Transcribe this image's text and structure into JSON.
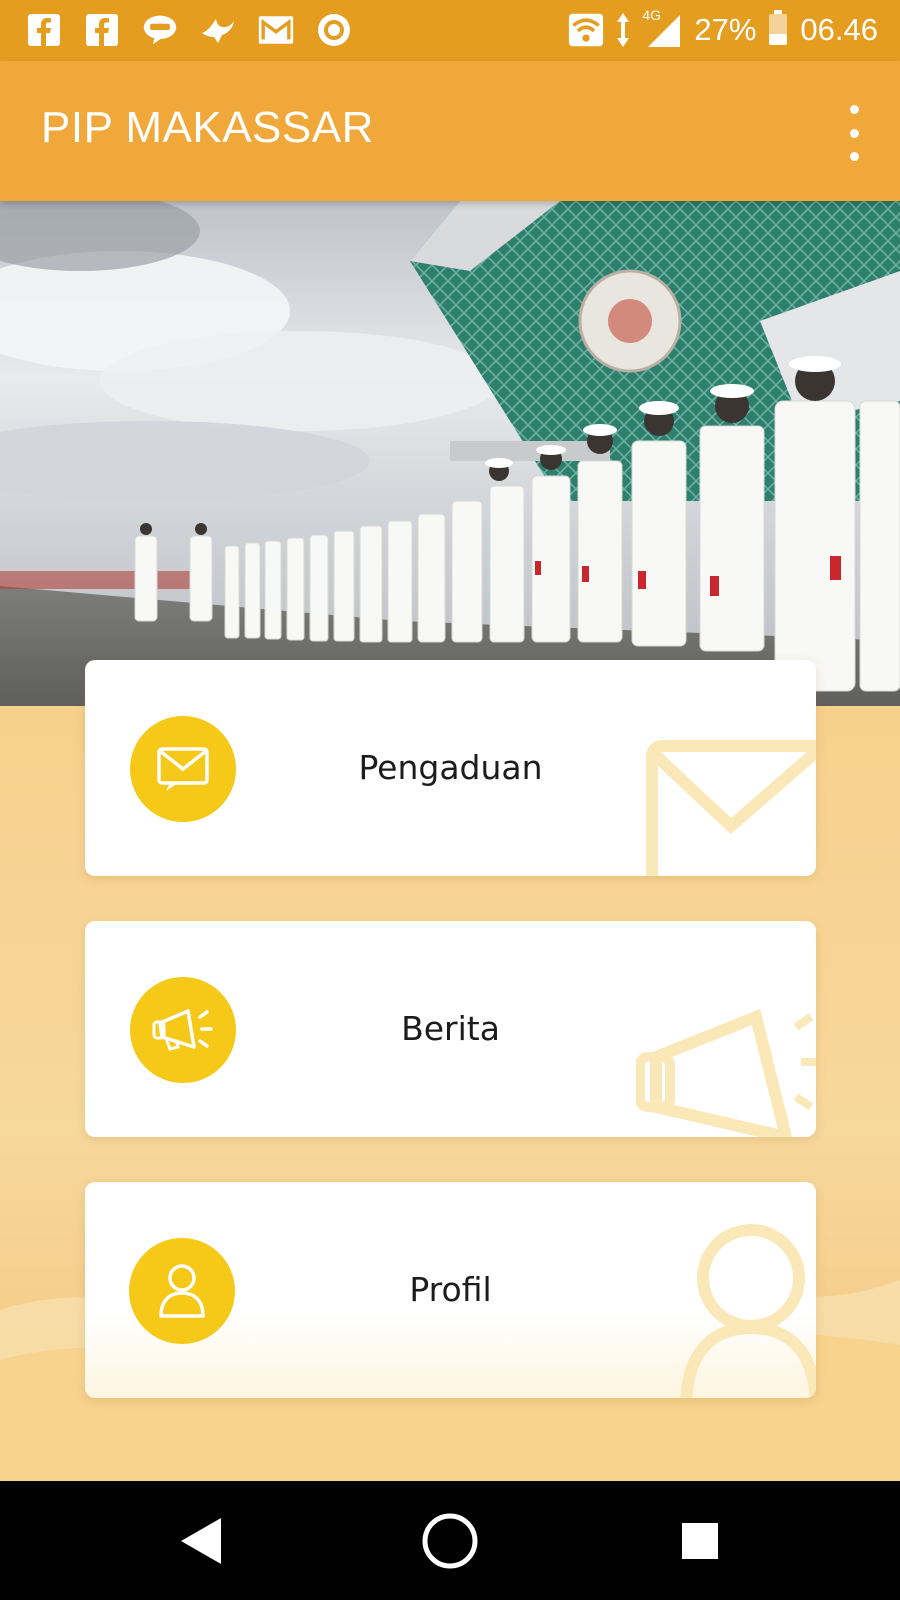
{
  "status_bar": {
    "notification_icons": [
      "facebook-icon",
      "facebook-icon",
      "line-icon",
      "bird-icon",
      "gmail-icon",
      "circle-app-icon"
    ],
    "network_label": "4G",
    "battery": "27%",
    "time": "06.46"
  },
  "app_bar": {
    "title": "PIP MAKASSAR",
    "menu_icon": "more-vert-icon"
  },
  "hero": {
    "image": "cadets-parade-photo"
  },
  "menu": [
    {
      "label": "Pengaduan",
      "icon": "mail-icon"
    },
    {
      "label": "Berita",
      "icon": "megaphone-icon"
    },
    {
      "label": "Profil",
      "icon": "person-icon"
    }
  ],
  "colors": {
    "status_bar": "#e49d1f",
    "app_bar": "#f0a83a",
    "accent_yellow": "#f6c919",
    "background": "#f7d596"
  },
  "nav": {
    "back": "back-icon",
    "home": "home-icon",
    "recents": "recents-icon"
  }
}
